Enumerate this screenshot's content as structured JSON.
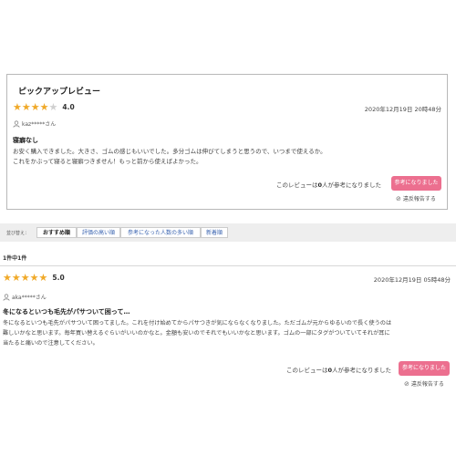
{
  "pickup": {
    "title": "ピックアップレビュー",
    "rating": 4,
    "score": "4.0",
    "date": "2020年12月19日 20時48分",
    "user": "kaz*****さん",
    "review_title": "寝癖なし",
    "body": [
      "お安く購入できました。大きさ、ゴムの感じもいいでした。多分ゴムは伸びてしまうと思うので、いつまで使えるか。",
      "これをかぶって寝ると寝癖つきません！もっと前から使えばよかった。"
    ],
    "helpful_prefix": "このレビューは",
    "helpful_count": "0",
    "helpful_suffix": "人が参考になりました",
    "helpful_button": "参考になりました",
    "report": "違反報告する"
  },
  "sort": {
    "label": "並び替え：",
    "tabs": [
      "おすすめ順",
      "評価の高い順",
      "参考になった人数の多い順",
      "新着順"
    ]
  },
  "result_count": "1件中1件",
  "reviews": [
    {
      "rating": 5,
      "score": "5.0",
      "date": "2020年12月19日 05時48分",
      "user": "aka*****さん",
      "review_title": "冬になるといつも毛先がパサついて困って…",
      "body": [
        "冬になるといつも毛先がパサついて困ってました。これを付け始めてからパサつきが気にならなくなりました。ただゴムが元からゆるいので長く使うのは",
        "難しいかなと思います。毎年買い替えるぐらいがいいのかなと。金額も安いのでそれでもいいかなと思います。ゴムの一部にタグがついていてそれが耳に",
        "当たると痛いので注意してください。"
      ],
      "helpful_prefix": "このレビューは",
      "helpful_count": "0",
      "helpful_suffix": "人が参考になりました",
      "helpful_button": "参考になりました",
      "report": "違反報告する"
    }
  ],
  "colors": {
    "star": "#f0a928",
    "button": "#ec6f8f",
    "link": "#3a64b0"
  }
}
